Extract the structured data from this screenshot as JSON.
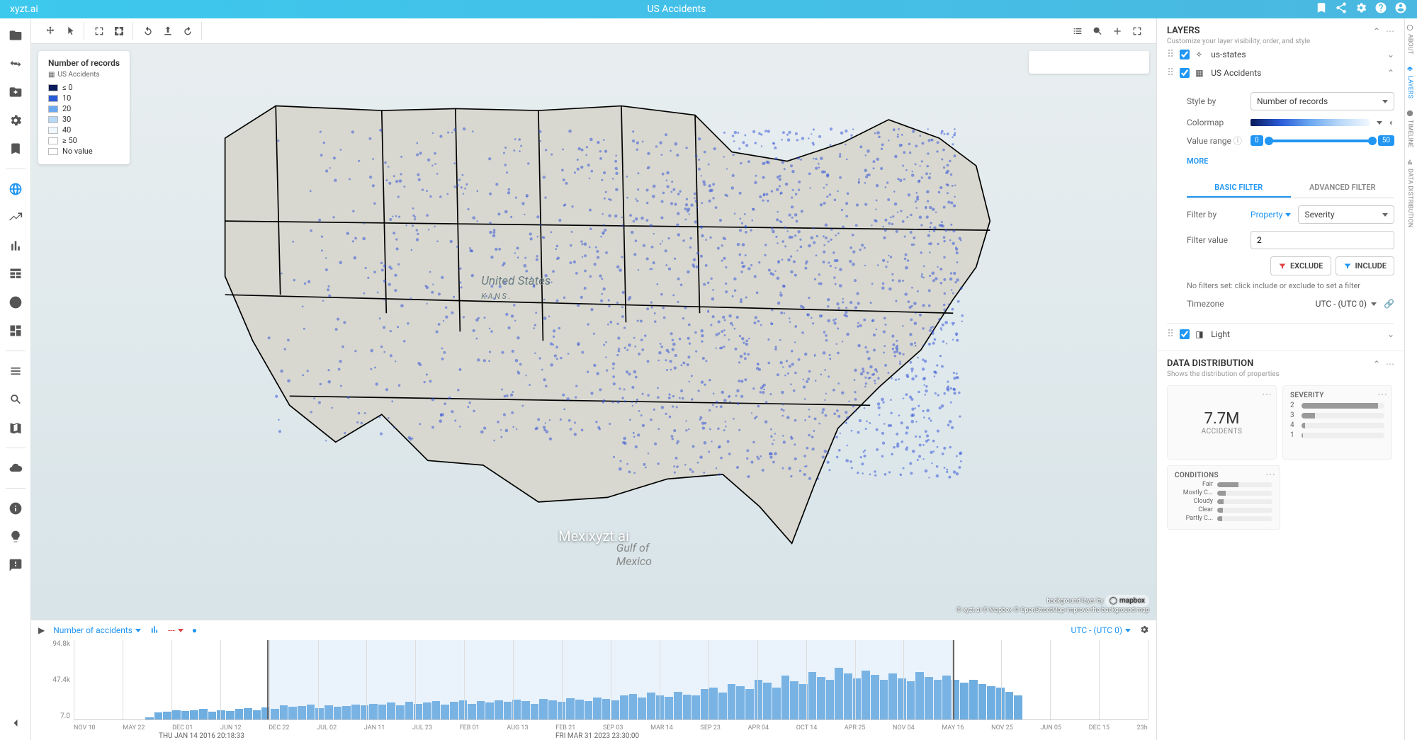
{
  "app": {
    "brand": "xyzt.ai",
    "title": "US Accidents",
    "watermark": "Mexixyzt.ai"
  },
  "topbar_icons": [
    "bookmark",
    "share",
    "settings",
    "help",
    "account"
  ],
  "map_tools_left": [
    "move",
    "select",
    "lasso",
    "crop",
    "rotate-ccw",
    "export",
    "rotate-cw"
  ],
  "map_tools_right": [
    "list",
    "search",
    "add",
    "fullscreen"
  ],
  "legend": {
    "title": "Number of records",
    "source": "US Accidents",
    "items": [
      {
        "label": "≤ 0",
        "color": "#0a1a5a"
      },
      {
        "label": "10",
        "color": "#2a5bd8"
      },
      {
        "label": "20",
        "color": "#6aa8f0"
      },
      {
        "label": "30",
        "color": "#b8d8f8"
      },
      {
        "label": "40",
        "color": "#f0f8ff"
      },
      {
        "label": "≥ 50",
        "color": "#ffffff"
      },
      {
        "label": "No value",
        "color": "#ffffff"
      }
    ]
  },
  "map_labels": {
    "country": "United States",
    "country_sub": "K A N S .",
    "gulf": "Gulf of",
    "gulf2": "Mexico",
    "attrib1": "background layer by",
    "attrib_logo": "mapbox",
    "attrib2": "© xyzt.ai © Mapbox © OpenStreetMap Improve the background map"
  },
  "timeline": {
    "metric": "Number of accidents",
    "tz": "UTC - (UTC 0)",
    "y": [
      "94.8k",
      "47.4k",
      "7.0"
    ],
    "x": [
      "NOV 10",
      "MAY 22",
      "DEC 01",
      "JUN 12",
      "DEC 22",
      "JUL 02",
      "JAN 11",
      "JUL 23",
      "FEB 01",
      "AUG 13",
      "FEB 21",
      "SEP 03",
      "MAR 14",
      "SEP 23",
      "APR 04",
      "OCT 14",
      "APR 25",
      "NOV 04",
      "MAY 16",
      "NOV 25",
      "JUN 05",
      "DEC 15",
      "23h"
    ],
    "sel_start": "THU JAN 14 2016 20:18:33",
    "sel_end": "FRI MAR 31 2023 23:30:00"
  },
  "chart_data": {
    "type": "bar",
    "title": "Number of accidents",
    "ylabel": "",
    "ylim": [
      7.0,
      94800
    ],
    "categories": [
      "NOV 10",
      "MAY 22",
      "DEC 01",
      "JUN 12",
      "DEC 22",
      "JUL 02",
      "JAN 11",
      "JUL 23",
      "FEB 01",
      "AUG 13",
      "FEB 21",
      "SEP 03",
      "MAR 14",
      "SEP 23",
      "APR 04",
      "OCT 14",
      "APR 25",
      "NOV 04",
      "MAY 16",
      "NOV 25",
      "JUN 05",
      "DEC 15",
      "23h"
    ],
    "values_pct": [
      0,
      0,
      0,
      0,
      0,
      0,
      0,
      0,
      3,
      9,
      10,
      12,
      11,
      12,
      13,
      10,
      12,
      11,
      13,
      14,
      12,
      15,
      13,
      18,
      16,
      17,
      19,
      14,
      18,
      16,
      17,
      19,
      18,
      20,
      19,
      21,
      18,
      22,
      20,
      21,
      23,
      19,
      22,
      24,
      20,
      23,
      21,
      24,
      22,
      25,
      23,
      20,
      26,
      24,
      22,
      27,
      25,
      23,
      28,
      26,
      24,
      30,
      32,
      28,
      34,
      30,
      29,
      35,
      31,
      30,
      38,
      40,
      34,
      45,
      42,
      38,
      50,
      46,
      40,
      55,
      48,
      45,
      60,
      54,
      50,
      65,
      58,
      52,
      62,
      56,
      50,
      58,
      52,
      48,
      60,
      54,
      50,
      55,
      50,
      46,
      50,
      45,
      42,
      40,
      35,
      30,
      0,
      0,
      0,
      0,
      0,
      0,
      0,
      0,
      0,
      0,
      0,
      0,
      0,
      0
    ]
  },
  "layers": {
    "panel_title": "LAYERS",
    "panel_sub": "Customize your layer visibility, order, and style",
    "items": [
      {
        "name": "us-states",
        "checked": true
      },
      {
        "name": "US Accidents",
        "checked": true,
        "expanded": true
      },
      {
        "name": "Light",
        "checked": true
      }
    ],
    "style_by_label": "Style by",
    "style_by_value": "Number of records",
    "colormap_label": "Colormap",
    "value_range_label": "Value range",
    "value_min": "0",
    "value_max": "50",
    "more": "MORE",
    "tabs": {
      "basic": "BASIC FILTER",
      "advanced": "ADVANCED FILTER"
    },
    "filter_by_label": "Filter by",
    "filter_by_type": "Property",
    "filter_by_value": "Severity",
    "filter_value_label": "Filter value",
    "filter_value": "2",
    "exclude": "EXCLUDE",
    "include": "INCLUDE",
    "hint": "No filters set: click include or exclude to set a filter",
    "timezone_label": "Timezone",
    "timezone_value": "UTC - (UTC 0)"
  },
  "distribution": {
    "title": "DATA DISTRIBUTION",
    "sub": "Shows the distribution of properties",
    "accidents_value": "7.7M",
    "accidents_label": "ACCIDENTS",
    "severity_title": "SEVERITY",
    "severity": [
      {
        "k": "2",
        "pct": 92
      },
      {
        "k": "3",
        "pct": 16
      },
      {
        "k": "4",
        "pct": 4
      },
      {
        "k": "1",
        "pct": 2
      }
    ],
    "conditions_title": "CONDITIONS",
    "conditions": [
      {
        "k": "Fair",
        "pct": 38
      },
      {
        "k": "Mostly C...",
        "pct": 16
      },
      {
        "k": "Cloudy",
        "pct": 12
      },
      {
        "k": "Clear",
        "pct": 10
      },
      {
        "k": "Partly C...",
        "pct": 9
      }
    ]
  },
  "edge_tabs": [
    "ABOUT",
    "LAYERS",
    "TIMELINE",
    "DATA DISTRIBUTION"
  ]
}
